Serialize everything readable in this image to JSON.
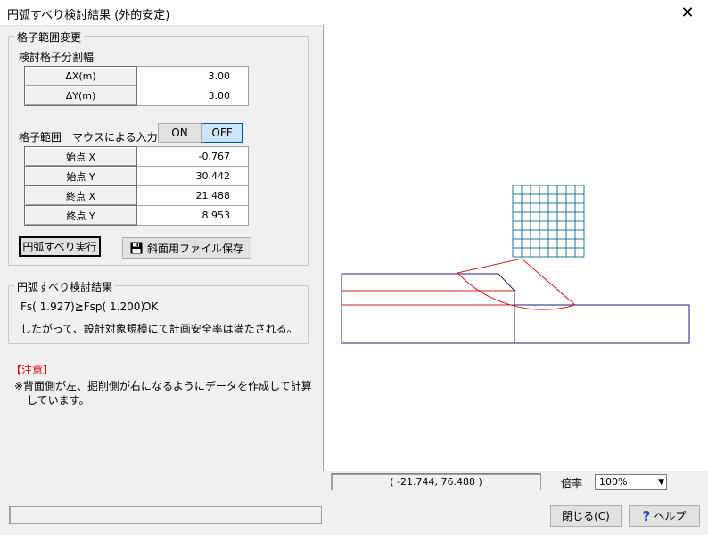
{
  "window": {
    "title": "円弧すべり検討結果 (外的安定)",
    "close_glyph": "✕"
  },
  "grid_group": {
    "legend": "格子範囲変更",
    "div_label": "検討格子分割幅",
    "div_rows": [
      {
        "label": "ΔX(m)",
        "value": "3.00"
      },
      {
        "label": "ΔY(m)",
        "value": "3.00"
      }
    ],
    "range_label": "格子範囲",
    "mouse_label": "マウスによる入力",
    "on_label": "ON",
    "off_label": "OFF",
    "range_rows": [
      {
        "label": "始点 X",
        "value": "-0.767"
      },
      {
        "label": "始点 Y",
        "value": "30.442"
      },
      {
        "label": "終点 X",
        "value": "21.488"
      },
      {
        "label": "終点 Y",
        "value": "8.953"
      }
    ],
    "run_button": "円弧すべり実行",
    "save_button": "斜面用ファイル保存"
  },
  "result_group": {
    "legend": "円弧すべり検討結果",
    "fs_text": "Fs( 1.927)≧Fsp( 1.200)",
    "ok_text": "OK",
    "conclusion": "したがって、設計対象規模にて計画安全率は満たされる。"
  },
  "caution": {
    "title": "【注意】",
    "line1": "※背面側が左、掘削側が右になるようにデータを作成して計算",
    "line2": "しています。"
  },
  "status": {
    "coords": "( -21.744, 76.488 )",
    "scale_label": "倍率",
    "scale_value": "100%"
  },
  "footer": {
    "close_button": "閉じる(C)",
    "help_button": "ヘルプ"
  },
  "colors": {
    "grid": "#1e7896",
    "structure": "#1e1e78",
    "slip": "#c81e1e"
  }
}
